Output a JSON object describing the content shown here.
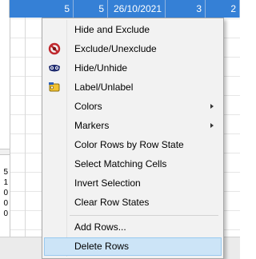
{
  "spreadsheet": {
    "top_row_cells": [
      "5",
      "5",
      "26/10/2021",
      "3",
      "2"
    ],
    "left_panel_values": [
      "5",
      "1",
      "0",
      "0",
      "0"
    ]
  },
  "context_menu": {
    "items": [
      {
        "label": "Hide and Exclude",
        "icon": "none"
      },
      {
        "label": "Exclude/Unexclude",
        "icon": "exclude-icon"
      },
      {
        "label": "Hide/Unhide",
        "icon": "hide-mask-icon"
      },
      {
        "label": "Label/Unlabel",
        "icon": "label-tag-icon"
      },
      {
        "label": "Colors",
        "submenu": true
      },
      {
        "label": "Markers",
        "submenu": true
      },
      {
        "label": "Color Rows by Row State"
      },
      {
        "label": "Select Matching Cells"
      },
      {
        "label": "Invert Selection"
      },
      {
        "label": "Clear Row States"
      },
      {
        "label": "Add Rows..."
      },
      {
        "label": "Delete Rows",
        "state": "highlighted"
      }
    ]
  },
  "colors": {
    "selection_blue": "#3580d6",
    "menu_background": "#f2f2f2",
    "menu_highlight": "#cce4f7",
    "exclude_icon_red": "#c0282d",
    "hide_icon_navy": "#1e2a6e",
    "label_icon_yellow": "#f2c230"
  }
}
